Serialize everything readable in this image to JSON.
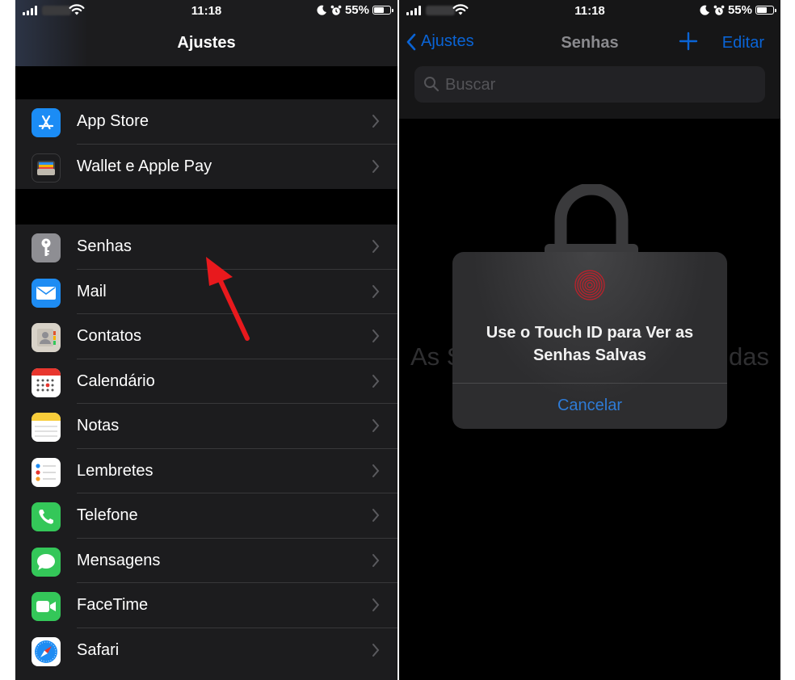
{
  "status_bar": {
    "time": "11:18",
    "battery": "55%",
    "battery_level": 0.55
  },
  "left": {
    "title": "Ajustes",
    "group1": [
      {
        "label": "App Store",
        "icon": "app-store-icon",
        "color": "#1b8cf5"
      },
      {
        "label": "Wallet e Apple Pay",
        "icon": "wallet-icon",
        "color": "#1c1c1e"
      }
    ],
    "group2": [
      {
        "label": "Senhas",
        "icon": "key-icon",
        "color": "#8e8e93"
      },
      {
        "label": "Mail",
        "icon": "mail-icon",
        "color": "#1e8cf3"
      },
      {
        "label": "Contatos",
        "icon": "contacts-icon",
        "color": "#d8d2c8"
      },
      {
        "label": "Calendário",
        "icon": "calendar-icon",
        "color": "#ffffff"
      },
      {
        "label": "Notas",
        "icon": "notes-icon",
        "color": "#ffffff"
      },
      {
        "label": "Lembretes",
        "icon": "reminders-icon",
        "color": "#ffffff"
      },
      {
        "label": "Telefone",
        "icon": "phone-icon",
        "color": "#34c759"
      },
      {
        "label": "Mensagens",
        "icon": "messages-icon",
        "color": "#34c759"
      },
      {
        "label": "FaceTime",
        "icon": "facetime-icon",
        "color": "#34c759"
      },
      {
        "label": "Safari",
        "icon": "safari-icon",
        "color": "#ffffff"
      }
    ]
  },
  "right": {
    "back_label": "Ajustes",
    "title": "Senhas",
    "edit_label": "Editar",
    "search_placeholder": "Buscar",
    "background_text_left": "As S",
    "background_text_right": "das",
    "alert": {
      "message_line1": "Use o Touch ID para Ver as",
      "message_line2": "Senhas Salvas",
      "cancel_label": "Cancelar"
    }
  },
  "colors": {
    "accent": "#0a64d6",
    "arrow": "#e8191d",
    "row_bg": "#1c1c1e"
  }
}
